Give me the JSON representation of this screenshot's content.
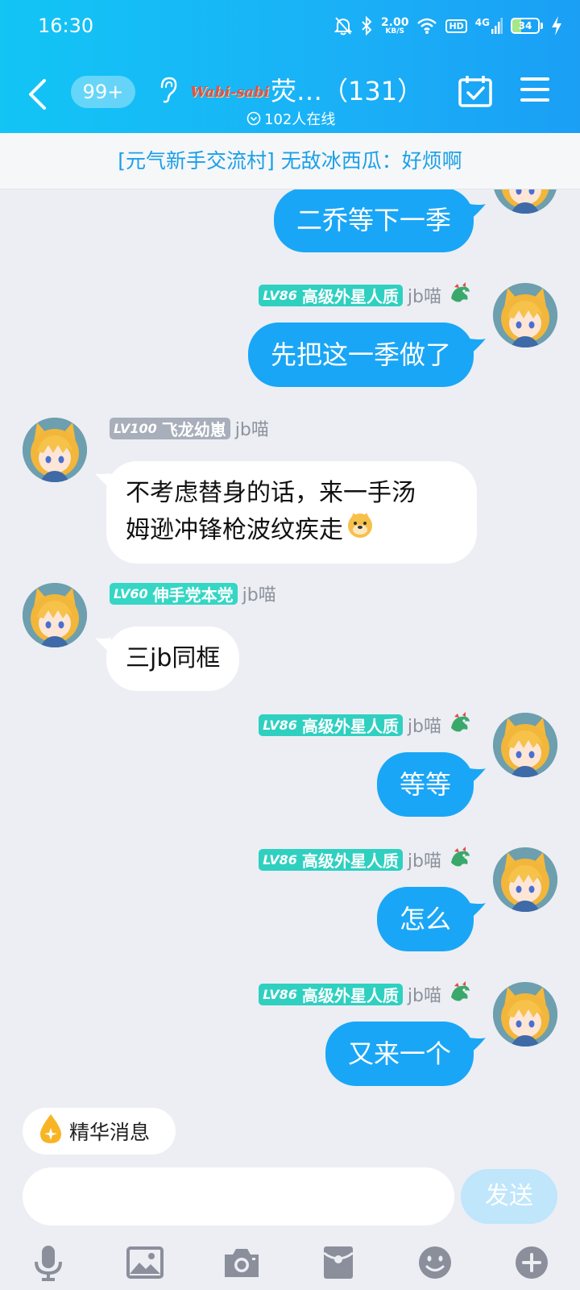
{
  "status_bar": {
    "time": "16:30",
    "net_speed_value": "2.00",
    "net_speed_unit": "KB/S",
    "hd_label": "HD",
    "network_label": "4G",
    "battery_level": "34",
    "battery_fraction": 0.34
  },
  "header": {
    "unread_count": "99+",
    "brand_logo_text": "Wabi-sabi",
    "group_name": "荧…（131）",
    "online_text": "102人在线"
  },
  "notice": {
    "text": "[元气新手交流村] 无敌冰西瓜：好烦啊"
  },
  "messages": [
    {
      "direction": "out",
      "text": "二乔等下一季"
    },
    {
      "direction": "out",
      "level": "LV86",
      "title": "高级外星人质",
      "sender": "jb喵",
      "text": "先把这一季做了"
    },
    {
      "direction": "in",
      "level": "LV100",
      "title": "飞龙幼崽",
      "sender": "jb喵",
      "text_line1": "不考虑替身的话，来一手汤",
      "text_line2": "姆逊冲锋枪波纹疾走"
    },
    {
      "direction": "in",
      "level": "LV60",
      "title": "伸手党本党",
      "sender": "jb喵",
      "text": "三jb同框"
    },
    {
      "direction": "out",
      "level": "LV86",
      "title": "高级外星人质",
      "sender": "jb喵",
      "text": "等等"
    },
    {
      "direction": "out",
      "level": "LV86",
      "title": "高级外星人质",
      "sender": "jb喵",
      "text": "怎么"
    },
    {
      "direction": "out",
      "level": "LV86",
      "title": "高级外星人质",
      "sender": "jb喵",
      "text": "又来一个"
    }
  ],
  "essence_button": {
    "label": "精华消息"
  },
  "composer": {
    "input_value": "",
    "input_placeholder": "",
    "send_label": "发送"
  },
  "toolbar": {
    "icons": [
      "microphone-icon",
      "image-icon",
      "camera-icon",
      "red-packet-icon",
      "emoji-icon",
      "plus-icon"
    ]
  },
  "colors": {
    "header_blue": "#1ab0f7",
    "bubble_out": "#1aa6f6",
    "badge_lv86": "#2fd0c0",
    "badge_lv100": "#a8aeba",
    "badge_lv60": "#35d6c4",
    "send_disabled": "#bfe6fb"
  }
}
